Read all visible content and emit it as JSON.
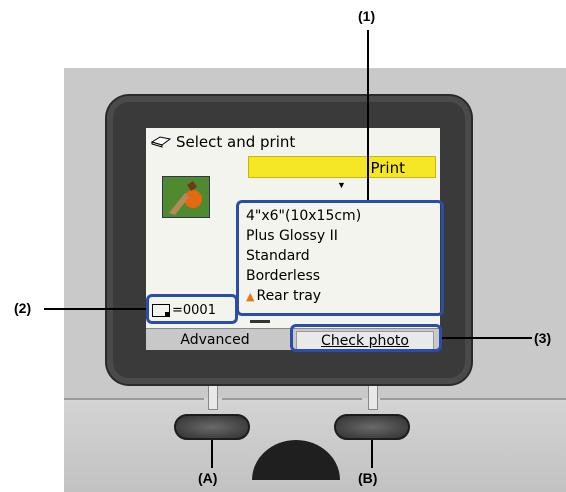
{
  "screen": {
    "title": "Select and print",
    "print_button": "Print",
    "settings": {
      "page_size": "4\"x6\"(10x15cm)",
      "media_type": "Plus Glossy II",
      "print_quality": "Standard",
      "border": "Borderless",
      "paper_source": "Rear tray"
    },
    "copies": "=0001",
    "left_softkey": "Advanced",
    "right_softkey": "Check photo"
  },
  "callouts": {
    "c1": "(1)",
    "c2": "(2)",
    "c3": "(3)",
    "a": "(A)",
    "b": "(B)"
  },
  "colors": {
    "highlight": "#2a4ea8",
    "print_bar": "#f5e626",
    "bezel": "#3a3a3a"
  }
}
